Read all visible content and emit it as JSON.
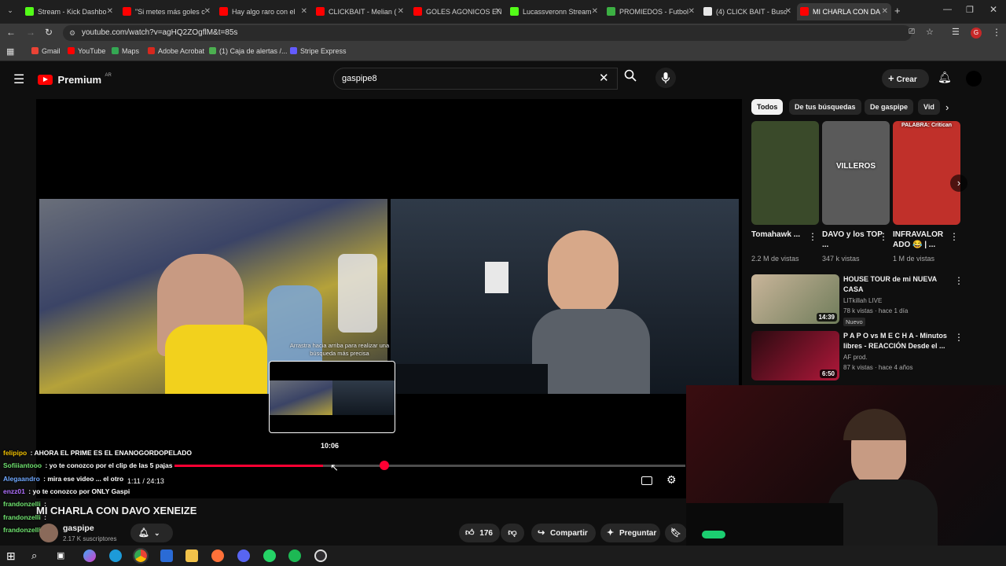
{
  "browser": {
    "tabs": [
      {
        "label": "Stream - Kick Dashbo",
        "color": "#53fc18"
      },
      {
        "label": "\"Si metes más goles c",
        "color": "#ff0000"
      },
      {
        "label": "Hay algo raro con el",
        "color": "#ff0000"
      },
      {
        "label": "CLICKBAIT - Melian (",
        "color": "#ff0000"
      },
      {
        "label": "GOLES AGONICOS EN",
        "color": "#ff0000"
      },
      {
        "label": "Lucassveronn Stream",
        "color": "#53fc18"
      },
      {
        "label": "PROMIEDOS - Futbol",
        "color": "#3cb043"
      },
      {
        "label": "(4) CLICK BAIT - Busc",
        "color": "#e7e7e7"
      },
      {
        "label": "MI CHARLA CON DA",
        "color": "#ff0000"
      }
    ],
    "url": "youtube.com/watch?v=agHQ2ZOgflM&t=85s",
    "bookmarks": [
      {
        "label": "Gmail",
        "color": "#ea4335"
      },
      {
        "label": "YouTube",
        "color": "#ff0000"
      },
      {
        "label": "Maps",
        "color": "#34a853"
      },
      {
        "label": "Adobe Acrobat",
        "color": "#d7281e"
      },
      {
        "label": "(1) Caja de alertas /...",
        "color": "#4caf50"
      },
      {
        "label": "Stripe Express",
        "color": "#635bff"
      }
    ]
  },
  "youtube": {
    "logo": "Premium",
    "region": "AR",
    "search_value": "gaspipe8",
    "create_label": "Crear"
  },
  "player": {
    "hint": "Arrastra hacia arriba para realizar una búsqueda más precisa",
    "preview_time": "10:06",
    "time_display": "1:11 / 24:13",
    "progress": 0.58,
    "title": "MI CHARLA CON DAVO XENEIZE",
    "channel": "gaspipe",
    "subscribers": "2.17 K suscriptores",
    "likes": "176",
    "share_label": "Compartir",
    "ask_label": "Preguntar"
  },
  "chat": [
    {
      "user": "felipipo",
      "user_color": "#f0c000",
      "text": "AHORA EL PRIME ES EL ENANOGORDOPELADO"
    },
    {
      "user": "Sofiiiantooo",
      "user_color": "#6fe36f",
      "text": "yo te conozco por el clip de las 5 pajas"
    },
    {
      "user": "Alegaandro",
      "user_color": "#6fa8ff",
      "text": "mira ese video ... el otro"
    },
    {
      "user": "enzz01",
      "user_color": "#b070ff",
      "text": "yo te conozco por ONLY Gaspi"
    },
    {
      "user": "frandonzelli",
      "user_color": "#6fe36f",
      "text": ""
    },
    {
      "user": "frandonzelli",
      "user_color": "#6fe36f",
      "text": ""
    },
    {
      "user": "frandonzelli",
      "user_color": "#6fe36f",
      "text": ""
    }
  ],
  "chips": [
    "Todos",
    "De tus búsquedas",
    "De gaspipe",
    "Vid"
  ],
  "shorts": [
    {
      "title": "Tomahawk ...",
      "views": "2.2 M de vistas",
      "bg": "#3a4a2a"
    },
    {
      "title": "DAVO y los TOP ...",
      "views": "347 k vistas",
      "bg": "#5a5a5a",
      "overlay": "VILLEROS"
    },
    {
      "title": "INFRAVALOR ADO 😂 | ...",
      "views": "1 M de vistas",
      "bg": "#c0302a",
      "overlay": "PALABRA: Critican"
    }
  ],
  "recommended": [
    {
      "title": "HOUSE TOUR de mi NUEVA CASA",
      "channel": "LITkillah LIVE",
      "meta": "78 k vistas · hace 1 día",
      "badge": "Nuevo",
      "duration": "14:39"
    },
    {
      "title": "P A P O vs M E C H A - Minutos libres - REACCIÓN Desde el ...",
      "channel": "AF prod.",
      "meta": "87 k vistas · hace 4 años",
      "badge": "",
      "duration": "6:50"
    }
  ]
}
